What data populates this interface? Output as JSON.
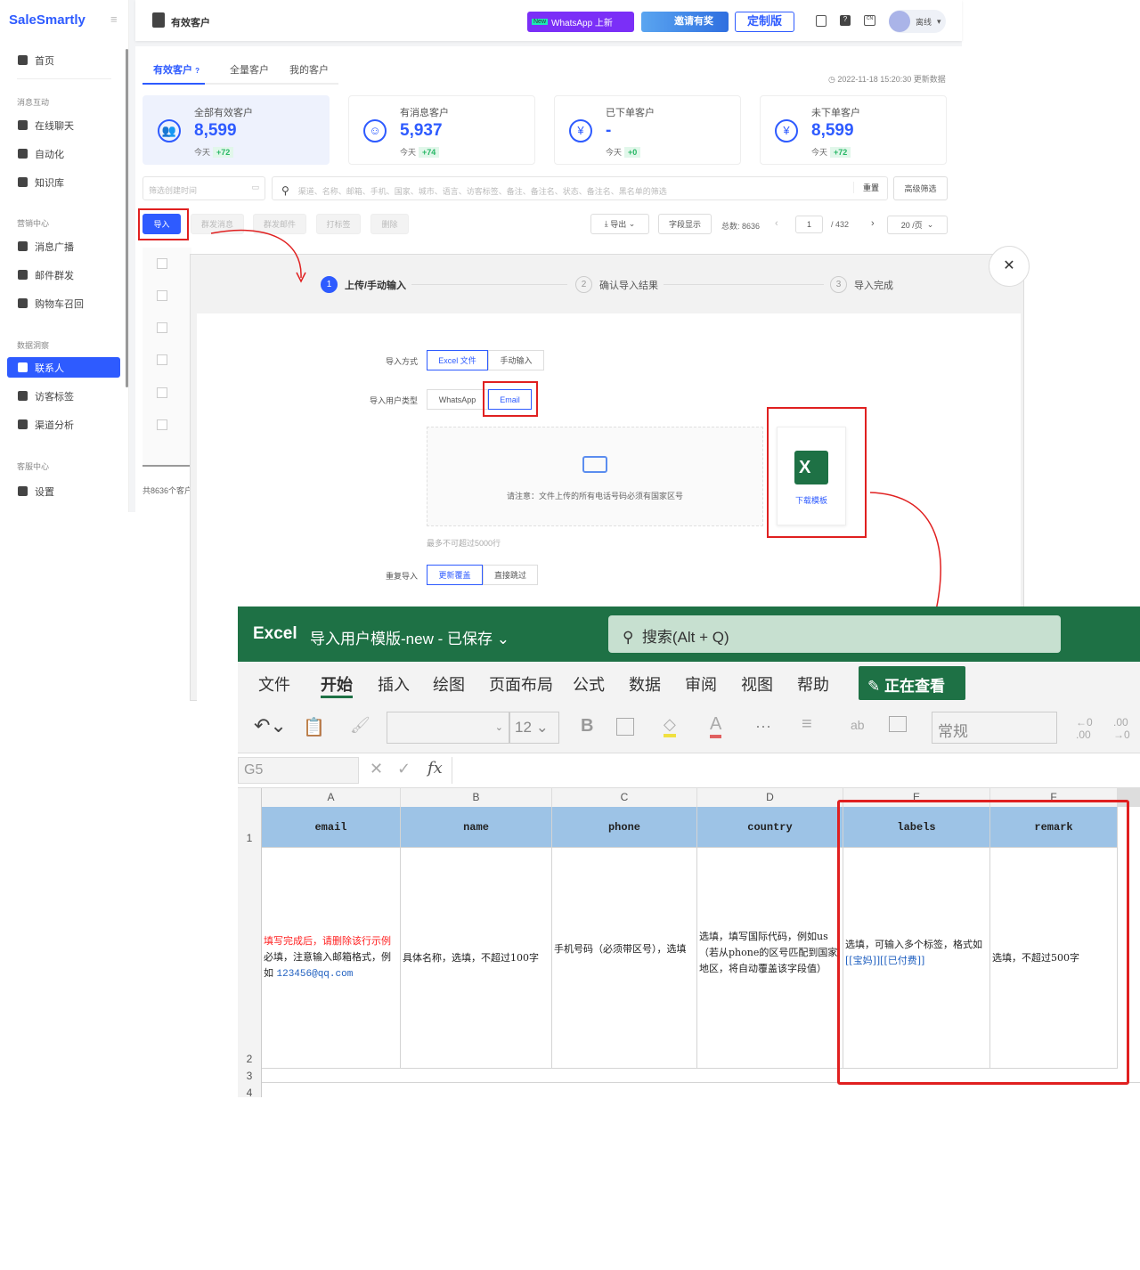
{
  "app": {
    "brand": "SaleSmartly",
    "page_title": "有效客户",
    "promo_whatsapp": "WhatsApp 上新",
    "promo_new_badge": "New",
    "invite": "邀请有奖",
    "custom": "定制版",
    "user": "离线"
  },
  "sidebar": {
    "home": "首页",
    "groups": [
      {
        "title": "消息互动",
        "items": [
          "在线聊天",
          "自动化",
          "知识库"
        ]
      },
      {
        "title": "营销中心",
        "items": [
          "消息广播",
          "邮件群发",
          "购物车召回"
        ]
      },
      {
        "title": "数据洞察",
        "items": [
          "联系人",
          "访客标签",
          "渠道分析"
        ]
      },
      {
        "title": "客服中心",
        "items": [
          "设置"
        ]
      }
    ]
  },
  "tabs": [
    "有效客户",
    "全量客户",
    "我的客户"
  ],
  "updated": "2022-11-18 15:20:30 更新数据",
  "cards": [
    {
      "title": "全部有效客户",
      "value": "8,599",
      "today": "今天",
      "delta": "+72"
    },
    {
      "title": "有消息客户",
      "value": "5,937",
      "today": "今天",
      "delta": "+74"
    },
    {
      "title": "已下单客户",
      "value": "-",
      "today": "今天",
      "delta": "+0"
    },
    {
      "title": "未下单客户",
      "value": "8,599",
      "today": "今天",
      "delta": "+72"
    }
  ],
  "filters": {
    "date_placeholder": "筛选创建时间",
    "search_placeholder": "渠道、名称、邮箱、手机、国家、城市、语言、访客标签、备注、备注名、状态、备注名、黑名单的筛选",
    "reset": "重置",
    "advanced": "高级筛选"
  },
  "actions": {
    "import": "导入",
    "bulk_msg": "群发消息",
    "bulk_mail": "群发邮件",
    "tag": "打标签",
    "delete": "删除",
    "export": "导出",
    "fields": "字段显示",
    "total": "总数: 8636",
    "page": "1",
    "pages": "/ 432",
    "per_page": "20 /页",
    "footer": "共8636个客户"
  },
  "dialog": {
    "steps": [
      "上传/手动输入",
      "确认导入结果",
      "导入完成"
    ],
    "import_mode_label": "导入方式",
    "mode_excel": "Excel 文件",
    "mode_manual": "手动输入",
    "user_type_label": "导入用户类型",
    "type_whatsapp": "WhatsApp",
    "type_email": "Email",
    "upload_note": "请注意：文件上传的所有电话号码必须有国家区号",
    "limit": "最多不可超过5000行",
    "template": "下载模板",
    "dup_label": "重复导入",
    "dup_update": "更新覆盖",
    "dup_skip": "直接跳过"
  },
  "excel": {
    "app": "Excel",
    "file": "导入用户模版-new - 已保存",
    "search": "搜索(Alt + Q)",
    "tabs": [
      "文件",
      "开始",
      "插入",
      "绘图",
      "页面布局",
      "公式",
      "数据",
      "审阅",
      "视图",
      "帮助"
    ],
    "viewing": "正在查看",
    "font_size": "12",
    "format": "常规",
    "cell_ref": "G5",
    "columns": [
      "A",
      "B",
      "C",
      "D",
      "E",
      "F"
    ],
    "headers": [
      "email",
      "name",
      "phone",
      "country",
      "labels",
      "remark"
    ],
    "row2": {
      "a_warn": "填写完成后，请删除该行示例",
      "a_text": "必填，注意输入邮箱格式，例如",
      "a_link": "123456@qq.com",
      "b": "具体名称，选填，不超过100字",
      "c": "手机号码（必须带区号），选填",
      "d": "选填，填写国际代码，例如us（若从phone的区号匹配到国家地区，将自动覆盖该字段值）",
      "e_text": "选填，可输入多个标签，格式如",
      "e_tags": "[[宝妈]][[已付费]]",
      "f": "选填，不超过500字"
    },
    "rows": [
      "1",
      "2",
      "3",
      "4"
    ]
  }
}
